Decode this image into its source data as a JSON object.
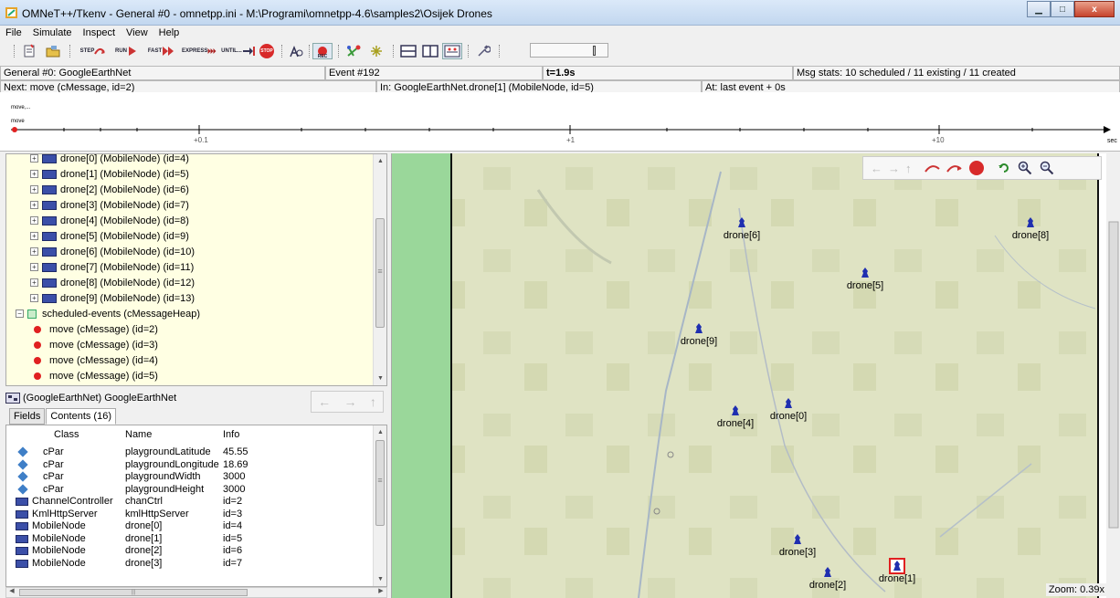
{
  "window": {
    "title": "OMNeT++/Tkenv - General #0 - omnetpp.ini - M:\\Programi\\omnetpp-4.6\\samples2\\Osijek Drones",
    "minimize_glyph": "▁",
    "maximize_glyph": "□",
    "close_glyph": "x"
  },
  "menu": [
    "File",
    "Simulate",
    "Inspect",
    "View",
    "Help"
  ],
  "toolbar": {
    "step": "STEP",
    "run": "RUN",
    "fast": "FAST",
    "express": "EXPRESS",
    "until": "UNTIL...",
    "stop": "STOP",
    "rec": "REC"
  },
  "status": {
    "config": "General #0: GoogleEarthNet",
    "event": "Event #192",
    "time": "t=1.9s",
    "msgstats": "Msg stats: 10 scheduled / 11 existing / 11 created",
    "next": "Next: move (cMessage, id=2)",
    "in": "In: GoogleEarthNet.drone[1] (MobileNode, id=5)",
    "at": "At: last event + 0s"
  },
  "timeline": {
    "msg_label_1": "move,...",
    "msg_label_2": "move",
    "ticks": [
      "+0.1",
      "+1",
      "+10"
    ],
    "unit": "sec"
  },
  "tree": {
    "drones": [
      "drone[0] (MobileNode) (id=4)",
      "drone[1] (MobileNode) (id=5)",
      "drone[2] (MobileNode) (id=6)",
      "drone[3] (MobileNode) (id=7)",
      "drone[4] (MobileNode) (id=8)",
      "drone[5] (MobileNode) (id=9)",
      "drone[6] (MobileNode) (id=10)",
      "drone[7] (MobileNode) (id=11)",
      "drone[8] (MobileNode) (id=12)",
      "drone[9] (MobileNode) (id=13)"
    ],
    "heap": "scheduled-events (cMessageHeap)",
    "messages": [
      "move (cMessage) (id=2)",
      "move (cMessage) (id=3)",
      "move (cMessage) (id=4)",
      "move (cMessage) (id=5)"
    ]
  },
  "inspector": {
    "title": "(GoogleEarthNet) GoogleEarthNet",
    "tabs": [
      "Fields",
      "Contents (16)"
    ],
    "columns": [
      "Class",
      "Name",
      "Info"
    ],
    "rows": [
      {
        "cls": "cPar",
        "name": "playgroundLatitude",
        "info": "45.55",
        "kind": "par"
      },
      {
        "cls": "cPar",
        "name": "playgroundLongitude",
        "info": "18.69",
        "kind": "par"
      },
      {
        "cls": "cPar",
        "name": "playgroundWidth",
        "info": "3000",
        "kind": "par"
      },
      {
        "cls": "cPar",
        "name": "playgroundHeight",
        "info": "3000",
        "kind": "par"
      },
      {
        "cls": "ChannelController",
        "name": "chanCtrl",
        "info": "id=2",
        "kind": "mod"
      },
      {
        "cls": "KmlHttpServer",
        "name": "kmlHttpServer",
        "info": "id=3",
        "kind": "mod"
      },
      {
        "cls": "MobileNode",
        "name": "drone[0]",
        "info": "id=4",
        "kind": "mod"
      },
      {
        "cls": "MobileNode",
        "name": "drone[1]",
        "info": "id=5",
        "kind": "mod"
      },
      {
        "cls": "MobileNode",
        "name": "drone[2]",
        "info": "id=6",
        "kind": "mod"
      },
      {
        "cls": "MobileNode",
        "name": "drone[3]",
        "info": "id=7",
        "kind": "mod"
      }
    ]
  },
  "canvas": {
    "zoom": "Zoom: 0.39x",
    "drones": [
      {
        "label": "drone[6]",
        "selected": false
      },
      {
        "label": "drone[8]",
        "selected": false
      },
      {
        "label": "drone[5]",
        "selected": false
      },
      {
        "label": "drone[9]",
        "selected": false
      },
      {
        "label": "drone[4]",
        "selected": false
      },
      {
        "label": "drone[0]",
        "selected": false
      },
      {
        "label": "drone[3]",
        "selected": false
      },
      {
        "label": "drone[2]",
        "selected": false
      },
      {
        "label": "drone[1]",
        "selected": true
      }
    ]
  },
  "colors": {
    "tree_bg": "#ffffe3",
    "map_bg": "#dfe4c4",
    "map_edge": "#9ad79a",
    "node": "#1f2fb0",
    "message": "#e02020",
    "selection": "#e02020"
  },
  "scroll_glyphs": {
    "up": "▲",
    "down": "▼",
    "left": "◀",
    "right": "▶",
    "grip": "≡",
    "hgrip": "|||"
  }
}
